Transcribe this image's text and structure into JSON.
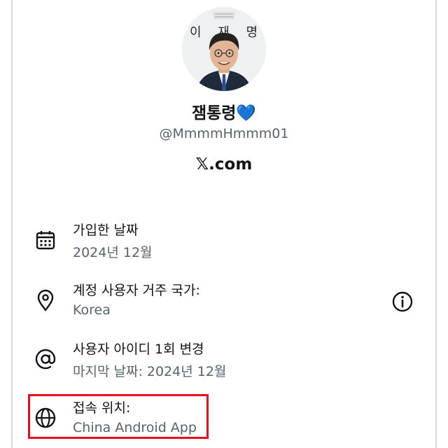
{
  "profile": {
    "avatar_name": "이 재 명",
    "display_name": "잼통령💙",
    "handle": "@MmmmHmmm01",
    "site": "𝕏.com"
  },
  "about": {
    "items": [
      {
        "title": "가입한 날짜",
        "value": "2024년 12월",
        "icon": "calendar-icon"
      },
      {
        "title": "계정 사용자 거주 국가:",
        "value": "Korea",
        "icon": "location-pin-icon"
      },
      {
        "title": "사용자 아이디 1회 변경",
        "value": "마지막 날짜: 2024년 12월",
        "icon": "at-sign-icon"
      },
      {
        "title": "접속 위치:",
        "value": "China Android App",
        "icon": "globe-icon"
      }
    ],
    "info_icon": "info-icon"
  },
  "colors": {
    "text_primary": "#0f1419",
    "text_secondary": "#536471",
    "highlight": "#e8101c",
    "heart": "#3b82f6"
  }
}
